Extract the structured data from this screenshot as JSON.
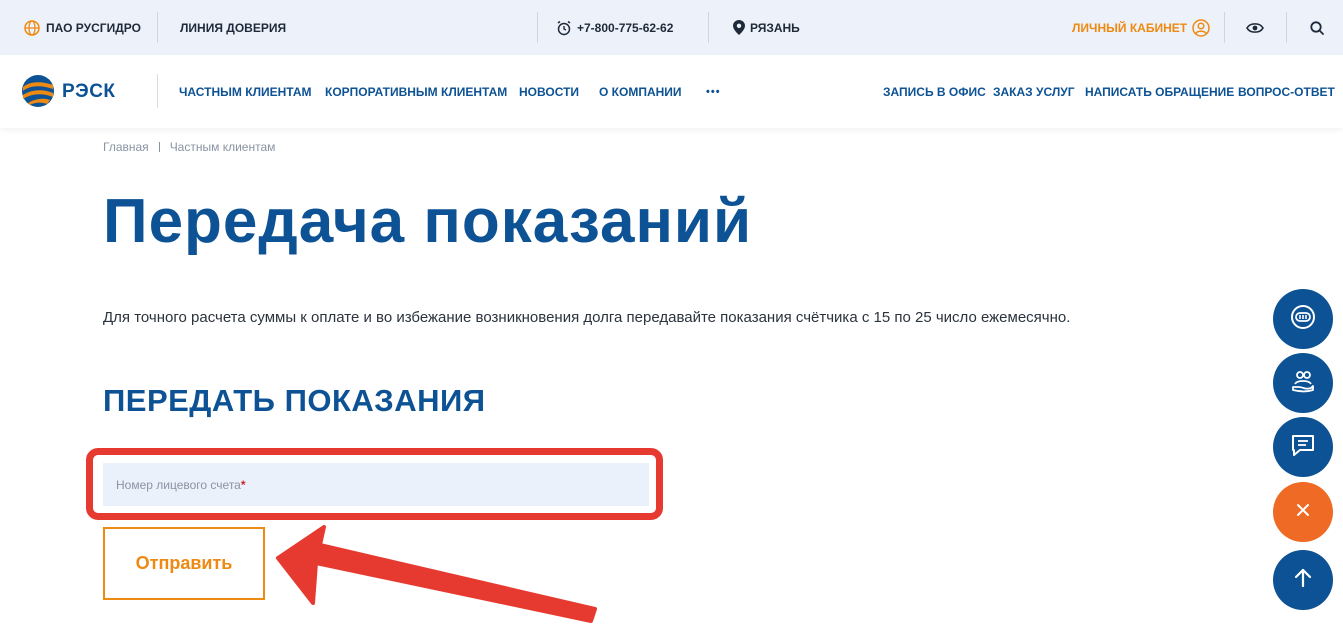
{
  "topbar": {
    "company": "ПАО РУСГИДРО",
    "hotline": "ЛИНИЯ ДОВЕРИЯ",
    "phone": "+7-800-775-62-62",
    "city": "РЯЗАНЬ",
    "cabinet": "ЛИЧНЫЙ КАБИНЕТ"
  },
  "logo": {
    "text": "РЭСК"
  },
  "nav": {
    "items": [
      "ЧАСТНЫМ КЛИЕНТАМ",
      "КОРПОРАТИВНЫМ КЛИЕНТАМ",
      "НОВОСТИ",
      "О КОМПАНИИ"
    ],
    "more": "•••",
    "right_items": [
      "ЗАПИСЬ В ОФИС",
      "ЗАКАЗ УСЛУГ",
      "НАПИСАТЬ ОБРАЩЕНИЕ",
      "ВОПРОС-ОТВЕТ"
    ]
  },
  "breadcrumb": [
    "Главная",
    "Частным клиентам"
  ],
  "page": {
    "title": "Передача показаний",
    "intro": "Для точного расчета суммы к оплате и во избежание возникновения долга передавайте показания счётчика с 15 по 25 число ежемесячно.",
    "subtitle": "ПЕРЕДАТЬ ПОКАЗАНИЯ"
  },
  "form": {
    "account_placeholder": "Номер лицевого счета",
    "required_mark": "*",
    "account_value": "",
    "submit_label": "Отправить"
  },
  "colors": {
    "brand_blue": "#0d5294",
    "accent_orange": "#ee8a12",
    "annotation_red": "#e63a30",
    "close_orange": "#ef6a24"
  },
  "icons": {
    "globe": "globe-icon",
    "alarm": "alarm-clock-icon",
    "location": "location-pin-icon",
    "user": "user-circle-icon",
    "eye": "eye-icon",
    "search": "search-icon",
    "fab1": "chat-bot-icon",
    "fab2": "hand-people-icon",
    "fab3": "message-icon",
    "fab4": "close-icon",
    "fab5": "arrow-up-icon"
  }
}
